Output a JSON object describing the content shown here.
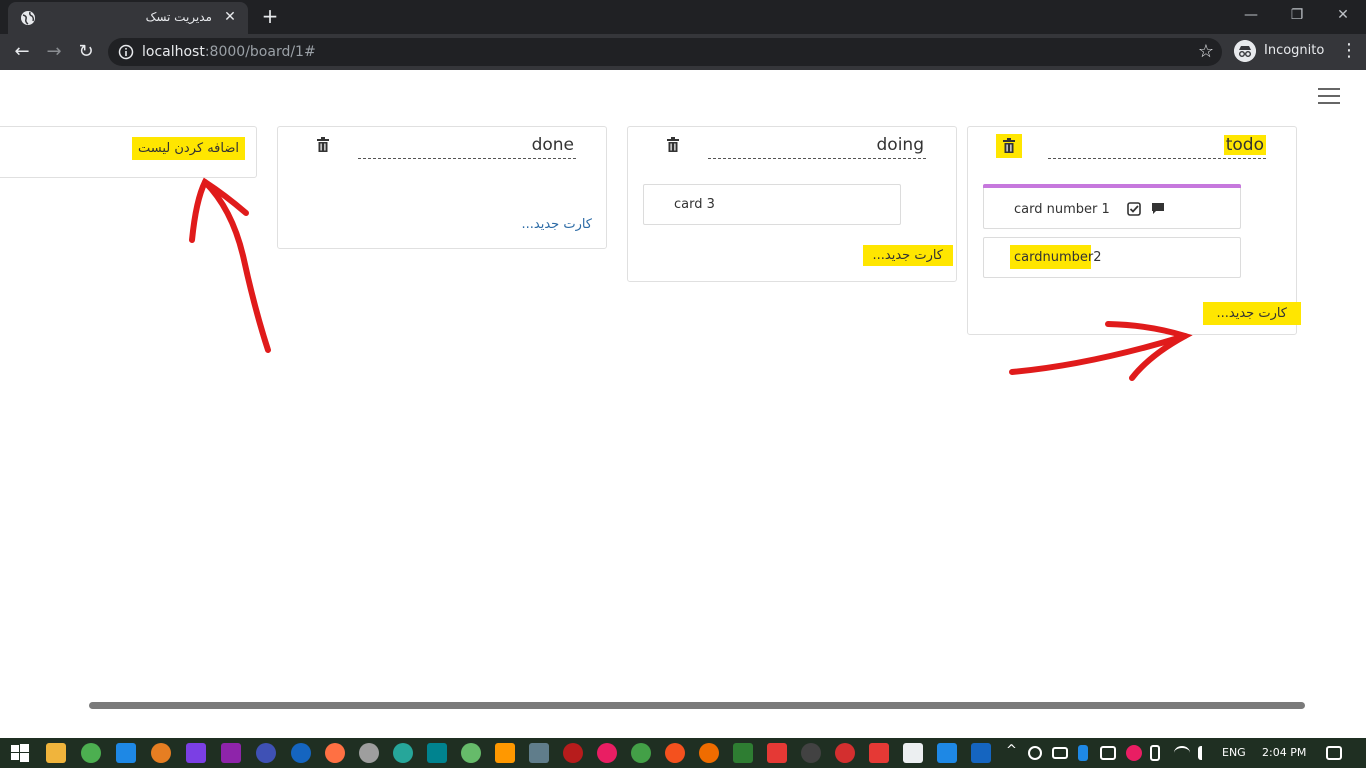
{
  "browser": {
    "tab_title": "مدیریت تسک",
    "tab_close": "✕",
    "new_tab": "+",
    "url_host": "localhost",
    "url_rest": ":8000/board/1#",
    "profile_label": "Incognito",
    "window_controls": [
      "—",
      "❐",
      "✕"
    ]
  },
  "board": {
    "lists": [
      {
        "title": "todo",
        "cards": [
          {
            "text": "card number 1",
            "label_color": "#c678dd",
            "has_checklist": true,
            "has_comment": true
          },
          {
            "text": "cardnumber2"
          }
        ],
        "new_card": "کارت جدید..."
      },
      {
        "title": "doing",
        "cards": [
          {
            "text": "card 3"
          }
        ],
        "new_card": "کارت جدید..."
      },
      {
        "title": "done",
        "cards": [],
        "new_card": "کارت جدید..."
      }
    ],
    "add_list": "اضافه کردن لیست"
  },
  "annotations": {
    "highlight_color": "#ffe600",
    "arrow_color": "#e01b1b"
  },
  "taskbar": {
    "language": "ENG",
    "time": "2:04 PM"
  }
}
